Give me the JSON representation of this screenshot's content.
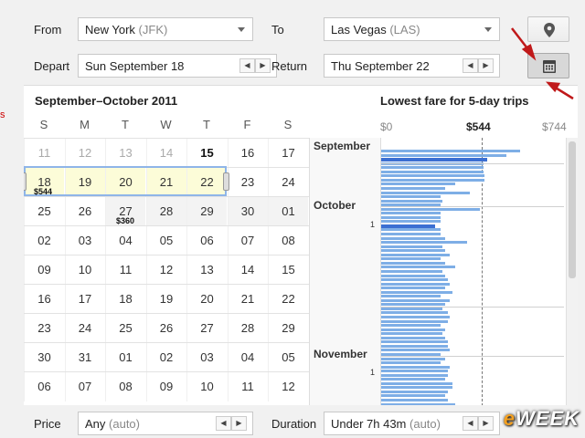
{
  "search": {
    "from_label": "From",
    "from_value": "New York",
    "from_code": "(JFK)",
    "to_label": "To",
    "to_value": "Las Vegas",
    "to_code": "(LAS)",
    "depart_label": "Depart",
    "depart_value": "Sun September 18",
    "return_label": "Return",
    "return_value": "Thu September 22",
    "stepper_prev": "◀",
    "stepper_next": "▶"
  },
  "calendar": {
    "title": "September–October 2011",
    "weekdays": [
      "S",
      "M",
      "T",
      "W",
      "T",
      "F",
      "S"
    ],
    "weeks": [
      [
        "11",
        "12",
        "13",
        "14",
        "15",
        "16",
        "17"
      ],
      [
        "18",
        "19",
        "20",
        "21",
        "22",
        "23",
        "24"
      ],
      [
        "25",
        "26",
        "27",
        "28",
        "29",
        "30",
        "01"
      ],
      [
        "02",
        "03",
        "04",
        "05",
        "06",
        "07",
        "08"
      ],
      [
        "09",
        "10",
        "11",
        "12",
        "13",
        "14",
        "15"
      ],
      [
        "16",
        "17",
        "18",
        "19",
        "20",
        "21",
        "22"
      ],
      [
        "23",
        "24",
        "25",
        "26",
        "27",
        "28",
        "29"
      ],
      [
        "30",
        "31",
        "01",
        "02",
        "03",
        "04",
        "05"
      ],
      [
        "06",
        "07",
        "08",
        "09",
        "10",
        "11",
        "12"
      ]
    ],
    "price_depart": "$544",
    "price_other": "$360"
  },
  "fare_chart": {
    "title": "Lowest fare for 5-day trips",
    "axis_min": "$0",
    "axis_mid": "$544",
    "axis_max": "$744",
    "months": [
      "September",
      "October",
      "November"
    ],
    "tick_label": "1"
  },
  "chart_data": {
    "type": "bar",
    "orientation": "horizontal",
    "title": "Lowest fare for 5-day trips",
    "xlim": [
      0,
      744
    ],
    "reference_value": 544,
    "values": [
      565,
      510,
      430,
      415,
      415,
      415,
      420,
      420,
      300,
      260,
      360,
      240,
      250,
      240,
      400,
      240,
      240,
      240,
      220,
      240,
      240,
      260,
      350,
      250,
      260,
      280,
      240,
      260,
      300,
      250,
      260,
      270,
      280,
      260,
      290,
      240,
      280,
      260,
      250,
      270,
      280,
      270,
      240,
      260,
      250,
      260,
      270,
      270,
      280,
      240,
      260,
      240,
      280,
      270,
      270,
      260,
      290,
      290,
      270,
      260,
      270,
      300
    ]
  },
  "footer": {
    "price_label": "Price",
    "price_value": "Any",
    "price_sub": "(auto)",
    "duration_label": "Duration",
    "duration_value": "Under 7h 43m",
    "duration_sub": "(auto)"
  },
  "icons": {
    "map": "map-pin-icon",
    "calendar": "calendar-icon"
  },
  "colors": {
    "bar": "#7eaee6",
    "bar_selected": "#3b6fd2",
    "range": "#fcfcd8",
    "selection": "#8fb5e8"
  },
  "watermark": {
    "e": "e",
    "rest": "WEEK"
  }
}
